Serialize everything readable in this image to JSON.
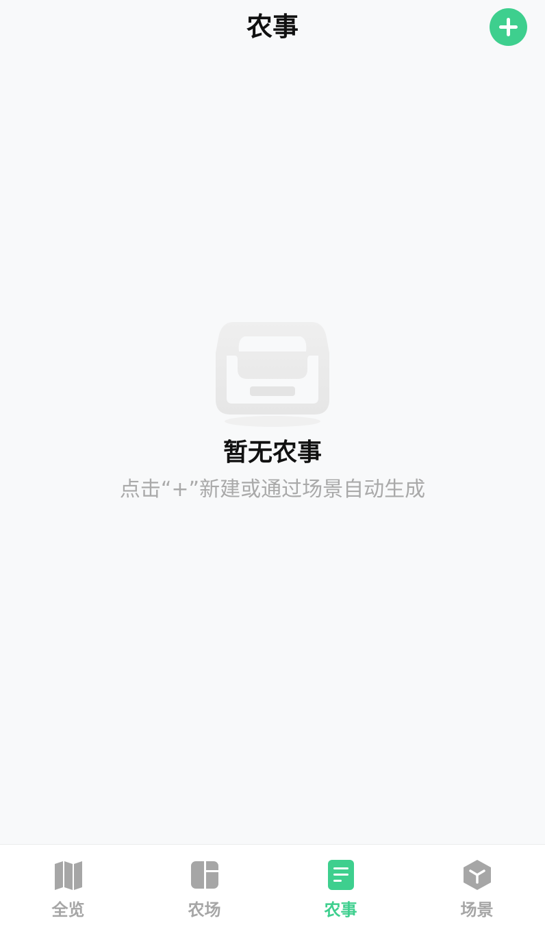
{
  "header": {
    "title": "农事",
    "add_icon": "plus-icon"
  },
  "empty_state": {
    "icon": "inbox-tray-icon",
    "title": "暂无农事",
    "hint": "点击“+”新建或通过场景自动生成"
  },
  "tabbar": {
    "items": [
      {
        "label": "全览",
        "icon": "map-icon",
        "active": false
      },
      {
        "label": "农场",
        "icon": "layout-panel-icon",
        "active": false
      },
      {
        "label": "农事",
        "icon": "document-icon",
        "active": true
      },
      {
        "label": "场景",
        "icon": "cube-icon",
        "active": false
      }
    ]
  },
  "colors": {
    "accent": "#3ecf8e",
    "inactive": "#a6a6a6",
    "background": "#f8f9fa"
  }
}
